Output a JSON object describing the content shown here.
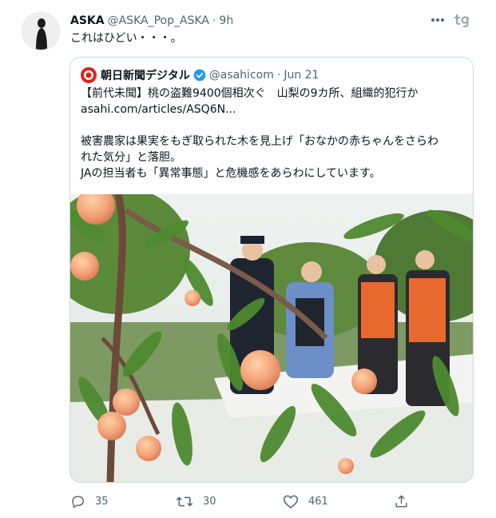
{
  "tweet": {
    "author_name": "ASKA",
    "author_handle": "@ASKA_Pop_ASKA",
    "separator": "·",
    "time": "9h",
    "text": "これはひどい・・・。"
  },
  "quote": {
    "author_name": "朝日新聞デジタル",
    "author_handle": "@asahicom",
    "separator": "·",
    "time": "Jun 21",
    "lines": [
      "【前代未聞】桃の盗難9400個相次ぐ　山梨の9カ所、組織的犯行か",
      "asahi.com/articles/ASQ6N...",
      "",
      "被害農家は果実をもぎ取られた木を見上げ「おなかの赤ちゃんをさらわ",
      "れた気分」と落胆。",
      "JAの担当者も「異常事態」と危機感をあらわにしています。"
    ]
  },
  "actions": {
    "reply_count": "35",
    "retweet_count": "30",
    "like_count": "461"
  },
  "colors": {
    "text_primary": "#0f1419",
    "text_secondary": "#536471",
    "border": "#cfd9de",
    "verified": "#1d9bf0",
    "asahi_red": "#d9261c"
  }
}
